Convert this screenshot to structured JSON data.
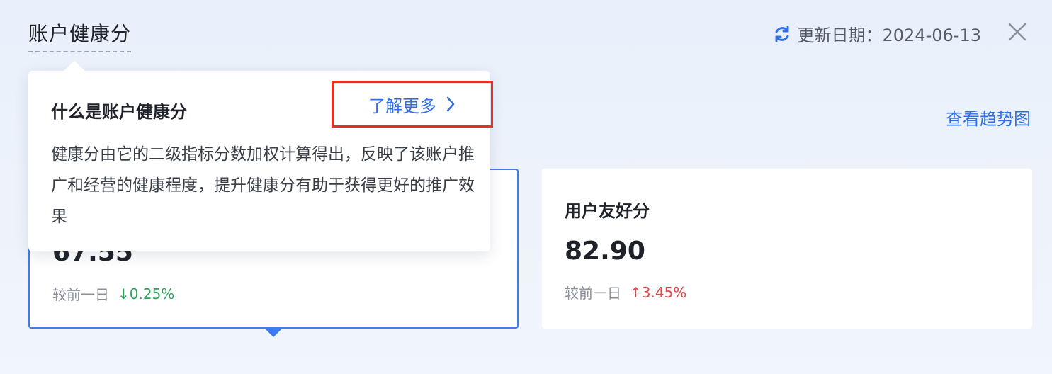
{
  "header": {
    "title": "账户健康分",
    "update_text": "更新日期：2024-06-13"
  },
  "links": {
    "trend": "查看趋势图"
  },
  "tooltip": {
    "title": "什么是账户健康分",
    "learn_more": "了解更多",
    "body": "健康分由它的二级指标分数加权计算得出，反映了该账户推广和经营的健康程度，提升健康分有助于获得更好的推广效果"
  },
  "cards": [
    {
      "value": "67.55",
      "compare_label": "较前一日",
      "delta": "0.25%",
      "direction": "down",
      "color": "#2aa35b"
    },
    {
      "name": "用户友好分",
      "value": "82.90",
      "compare_label": "较前一日",
      "delta": "3.45%",
      "direction": "up",
      "color": "#e54545"
    }
  ],
  "colors": {
    "accent": "#2f6fe8",
    "selected_border": "#3e7bf0",
    "highlight_box": "#e53125"
  },
  "icons": {
    "refresh": "refresh-icon",
    "close": "close-icon",
    "chevron": "chevron-right-icon",
    "arrow_down": "arrow-down-icon",
    "arrow_up": "arrow-up-icon"
  }
}
